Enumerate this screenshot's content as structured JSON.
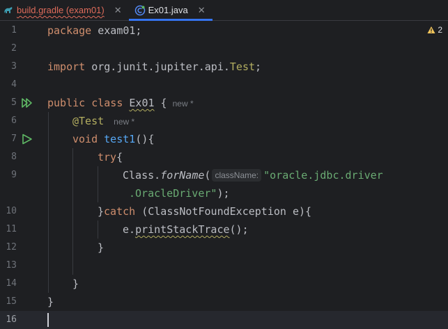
{
  "tabs": [
    {
      "label": "build.gradle (exam01)",
      "close": "✕",
      "icon": "gradle-icon",
      "active": false
    },
    {
      "label": "Ex01.java",
      "close": "✕",
      "icon": "java-class-icon",
      "active": true
    }
  ],
  "warnings": {
    "count": "2",
    "icon": "warning-icon"
  },
  "line_numbers": [
    "1",
    "2",
    "3",
    "4",
    "5",
    "6",
    "7",
    "8",
    "9",
    "",
    "10",
    "11",
    "12",
    "13",
    "14",
    "15",
    "16"
  ],
  "code": {
    "l1_kw": "package",
    "l1_rest": " exam01;",
    "l3_kw": "import",
    "l3_rest": " org.junit.jupiter.api.",
    "l3_cls": "Test",
    "l3_end": ";",
    "l5_kw": "public class",
    "l5_name": "Ex01",
    "l5_brace": " {",
    "l5_hint": "new *",
    "l6_ann": "@Test",
    "l6_hint": "new *",
    "l7_kw": "void",
    "l7_fn": "test1",
    "l7_rest": "(){",
    "l8_kw": "try",
    "l8_rest": "{",
    "l9_cls": "Class.",
    "l9_fn": "forName",
    "l9_paren": "(",
    "l9_param": "className:",
    "l9_str": "\"oracle.jdbc.driver",
    "l9b_str": ".OracleDriver\"",
    "l9b_end": ");",
    "l10_brace": "}",
    "l10_kw": "catch",
    "l10_rest": " (ClassNotFoundException e){",
    "l11_pre": "e.",
    "l11_fn": "printStackTrace",
    "l11_end": "();",
    "l12": "}",
    "l14": "}",
    "l15": "}"
  }
}
